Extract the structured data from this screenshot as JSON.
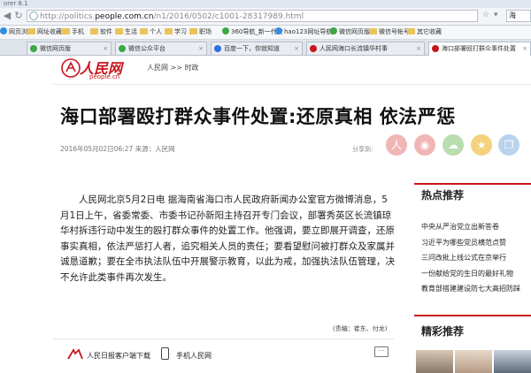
{
  "window": {
    "title": "orer 8.1"
  },
  "address_bar": {
    "url_prefix": "http://politics.",
    "url_domain": "people.com.cn",
    "url_path": "/n1/2016/0502/c1001-28317989.html",
    "right_label": "海"
  },
  "bookmarks": [
    {
      "label": "网页浏览",
      "color": "#2f8ee0"
    },
    {
      "label": "网址收藏夹",
      "color": "#e9c45a"
    },
    {
      "label": "手机",
      "color": "#e9c45a"
    },
    {
      "label": "软件",
      "color": "#e9c45a"
    },
    {
      "label": "生活",
      "color": "#e9c45a"
    },
    {
      "label": "个人",
      "color": "#e9c45a"
    },
    {
      "label": "学习",
      "color": "#e9c45a"
    },
    {
      "label": "职场",
      "color": "#e9c45a"
    },
    {
      "label": "360导航_新一代安",
      "color": "#3aa845"
    },
    {
      "label": "hao123网址导航",
      "color": "#2f8ee0"
    },
    {
      "label": "微信网页版",
      "color": "#3aa845"
    },
    {
      "label": "微信号帐号",
      "color": "#e9c45a"
    },
    {
      "label": "其它收藏",
      "color": "#e9c45a"
    }
  ],
  "tabs": [
    {
      "label": "微信网页版",
      "color": "#3aa845",
      "active": false
    },
    {
      "label": "微信公众平台",
      "color": "#3aa845",
      "active": false
    },
    {
      "label": "百度一下，你就知道",
      "color": "#2f6fe0",
      "active": false
    },
    {
      "label": "人民网海口长流镇华村事",
      "color": "#c8161d",
      "active": false
    },
    {
      "label": "海口部署殴打群众事件处置",
      "color": "#c8161d",
      "active": true
    }
  ],
  "site": {
    "logo": "人民网",
    "logo_sub": "people.cn",
    "breadcrumb": "人民网 >> 时政"
  },
  "article": {
    "headline": "海口部署殴打群众事件处置:还原真相 依法严惩",
    "meta": "2016年05月02日06:27   来源：人民网",
    "share_label": "分享到:",
    "body": "人民网北京5月2日电 据海南省海口市人民政府新闻办公室官方微博消息，5月1日上午，省委常委、市委书记孙新阳主持召开专门会议，部署秀英区长流镇琼华村拆违行动中发生的殴打群众事件的处置工作。他强调，要立即展开调查，还原事实真相，依法严惩打人者，追究相关人员的责任；要看望慰问被打群众及家属并诚恳道歉；要在全市执法队伍中开展警示教育，以此为戒，加强执法队伍管理，决不允许此类事件再次发生。",
    "editor": "(责编：崔东、付龙)"
  },
  "share_buttons": [
    {
      "name": "renmin-weibo-icon",
      "glyph": "人",
      "color": "#f0b5b5"
    },
    {
      "name": "sina-weibo-icon",
      "glyph": "◉",
      "color": "#f0b5b5"
    },
    {
      "name": "wechat-icon",
      "glyph": "☁",
      "color": "#b9ddb0"
    },
    {
      "name": "qzone-icon",
      "glyph": "★",
      "color": "#f4d27e"
    },
    {
      "name": "copy-icon",
      "glyph": "❐",
      "color": "#b9d3ee"
    }
  ],
  "footer": {
    "download": "人民日报客户端下载",
    "mobile": "手机人民网",
    "comment": "···"
  },
  "sidebar": {
    "hot_title": "热点推荐",
    "hot_items": [
      "中央从严治党立出新答卷",
      "习近平为哪些党员横范点赞",
      "三问改批上线公式在京举行",
      "一份献给党的生日的最好礼物",
      "教育部搭建建设防七大高招防踩"
    ],
    "featured_title": "精彩推荐"
  },
  "colors": {
    "brand_red": "#c8161d"
  }
}
